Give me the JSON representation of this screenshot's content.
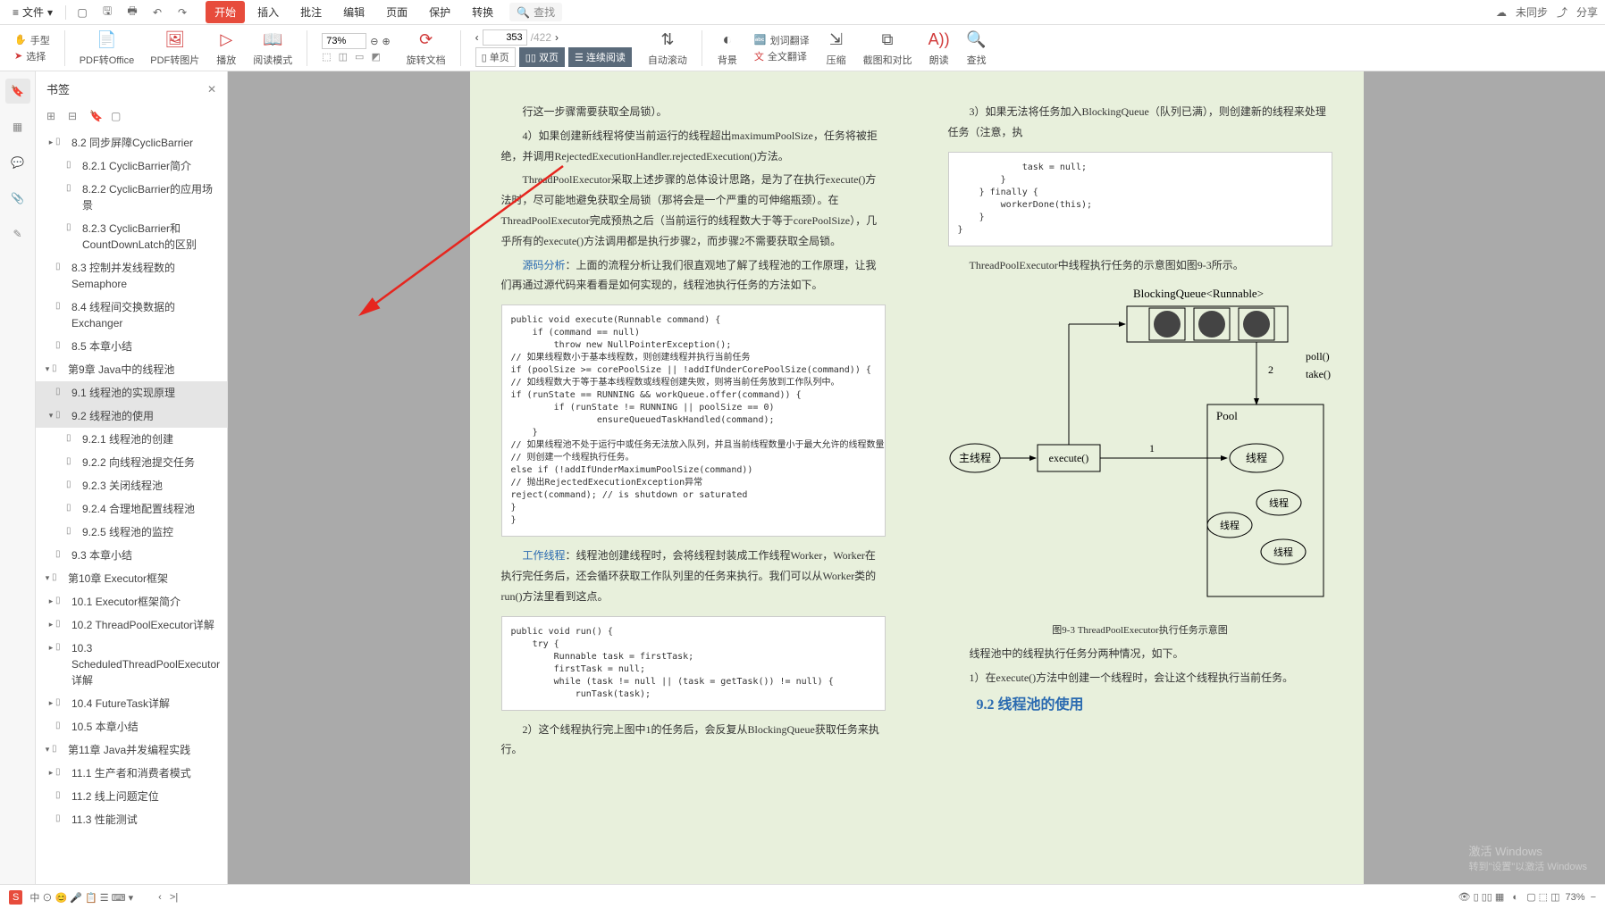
{
  "topbar": {
    "file_label": "文件",
    "search_placeholder": "查找",
    "tabs": [
      "开始",
      "插入",
      "批注",
      "编辑",
      "页面",
      "保护",
      "转换"
    ],
    "sync_label": "未同步",
    "share_label": "分享"
  },
  "ribbon": {
    "hand_tool": "手型",
    "select_tool": "选择",
    "pdf_to_office": "PDF转Office",
    "pdf_to_image": "PDF转图片",
    "play": "播放",
    "read_mode": "阅读模式",
    "zoom_value": "73%",
    "rotate": "旋转文档",
    "current_page": "353",
    "total_pages": "/422",
    "single_page": "单页",
    "dual_page": "双页",
    "continuous": "连续阅读",
    "auto_scroll": "自动滚动",
    "background": "背景",
    "word_translate": "划词翻译",
    "full_translate": "全文翻译",
    "compress": "压缩",
    "crop_compare": "截图和对比",
    "read_aloud": "朗读",
    "find": "查找"
  },
  "bookmarks": {
    "title": "书签",
    "items": [
      {
        "text": "8.2 同步屏障CyclicBarrier",
        "level": 1,
        "arrow": "▸"
      },
      {
        "text": "8.2.1 CyclicBarrier简介",
        "level": 2
      },
      {
        "text": "8.2.2 CyclicBarrier的应用场景",
        "level": 2
      },
      {
        "text": "8.2.3 CyclicBarrier和CountDownLatch的区别",
        "level": 2
      },
      {
        "text": "8.3 控制并发线程数的Semaphore",
        "level": 1
      },
      {
        "text": "8.4 线程间交换数据的Exchanger",
        "level": 1
      },
      {
        "text": "8.5 本章小结",
        "level": 1
      },
      {
        "text": "第9章 Java中的线程池",
        "level": 0,
        "arrow": "▾"
      },
      {
        "text": "9.1 线程池的实现原理",
        "level": 1,
        "selected": true
      },
      {
        "text": "9.2 线程池的使用",
        "level": 1,
        "arrow": "▾",
        "selected": true
      },
      {
        "text": "9.2.1 线程池的创建",
        "level": 2
      },
      {
        "text": "9.2.2 向线程池提交任务",
        "level": 2
      },
      {
        "text": "9.2.3 关闭线程池",
        "level": 2
      },
      {
        "text": "9.2.4 合理地配置线程池",
        "level": 2
      },
      {
        "text": "9.2.5 线程池的监控",
        "level": 2
      },
      {
        "text": "9.3 本章小结",
        "level": 1
      },
      {
        "text": "第10章 Executor框架",
        "level": 0,
        "arrow": "▾"
      },
      {
        "text": "10.1 Executor框架简介",
        "level": 1,
        "arrow": "▸"
      },
      {
        "text": "10.2 ThreadPoolExecutor详解",
        "level": 1,
        "arrow": "▸"
      },
      {
        "text": "10.3 ScheduledThreadPoolExecutor详解",
        "level": 1,
        "arrow": "▸"
      },
      {
        "text": "10.4 FutureTask详解",
        "level": 1,
        "arrow": "▸"
      },
      {
        "text": "10.5 本章小结",
        "level": 1
      },
      {
        "text": "第11章 Java并发编程实践",
        "level": 0,
        "arrow": "▾"
      },
      {
        "text": "11.1 生产者和消费者模式",
        "level": 1,
        "arrow": "▸"
      },
      {
        "text": "11.2 线上问题定位",
        "level": 1
      },
      {
        "text": "11.3 性能测试",
        "level": 1
      }
    ]
  },
  "content": {
    "left": {
      "p1": "行这一步骤需要获取全局锁）。",
      "p2": "4）如果创建新线程将使当前运行的线程超出maximumPoolSize，任务将被拒绝，并调用RejectedExecutionHandler.rejectedExecution()方法。",
      "p3": "ThreadPoolExecutor采取上述步骤的总体设计思路，是为了在执行execute()方法时，尽可能地避免获取全局锁（那将会是一个严重的可伸缩瓶颈）。在ThreadPoolExecutor完成预热之后（当前运行的线程数大于等于corePoolSize），几乎所有的execute()方法调用都是执行步骤2，而步骤2不需要获取全局锁。",
      "p4_prefix": "源码分析",
      "p4": "：上面的流程分析让我们很直观地了解了线程池的工作原理，让我们再通过源代码来看看是如何实现的，线程池执行任务的方法如下。",
      "code1": "public void execute(Runnable command) {\n    if (command == null)\n        throw new NullPointerException();\n// 如果线程数小于基本线程数，则创建线程并执行当前任务\nif (poolSize >= corePoolSize || !addIfUnderCorePoolSize(command)) {\n// 如线程数大于等于基本线程数或线程创建失败，则将当前任务放到工作队列中。\nif (runState == RUNNING && workQueue.offer(command)) {\n        if (runState != RUNNING || poolSize == 0)\n                ensureQueuedTaskHandled(command);\n    }\n// 如果线程池不处于运行中或任务无法放入队列，并且当前线程数量小于最大允许的线程数量，\n// 则创建一个线程执行任务。\nelse if (!addIfUnderMaximumPoolSize(command))\n// 抛出RejectedExecutionException异常\nreject(command); // is shutdown or saturated\n}\n}",
      "p5_prefix": "工作线程",
      "p5": "：线程池创建线程时，会将线程封装成工作线程Worker，Worker在执行完任务后，还会循环获取工作队列里的任务来执行。我们可以从Worker类的run()方法里看到这点。",
      "code2": "public void run() {\n    try {\n        Runnable task = firstTask;\n        firstTask = null;\n        while (task != null || (task = getTask()) != null) {\n            runTask(task);",
      "p6": "2）这个线程执行完上图中1的任务后，会反复从BlockingQueue获取任务来执行。"
    },
    "right": {
      "p1": "3）如果无法将任务加入BlockingQueue（队列已满），则创建新的线程来处理任务（注意，执",
      "code1": "            task = null;\n        }\n    } finally {\n        workerDone(this);\n    }\n}",
      "p2": "ThreadPoolExecutor中线程执行任务的示意图如图9-3所示。",
      "fig_title": "BlockingQueue<Runnable>",
      "fig_poll": "poll()",
      "fig_take": "take()",
      "fig_pool": "Pool",
      "fig_main": "主线程",
      "fig_execute": "execute()",
      "fig_thread": "线程",
      "fig_num1": "1",
      "fig_num2": "2",
      "fig_caption": "图9-3 ThreadPoolExecutor执行任务示意图",
      "p3": "线程池中的线程执行任务分两种情况，如下。",
      "p4": "1）在execute()方法中创建一个线程时，会让这个线程执行当前任务。",
      "section": "9.2 线程池的使用"
    }
  },
  "status": {
    "zoom": "73%"
  },
  "watermark": {
    "line1": "激活 Windows",
    "line2": "转到\"设置\"以激活 Windows"
  }
}
